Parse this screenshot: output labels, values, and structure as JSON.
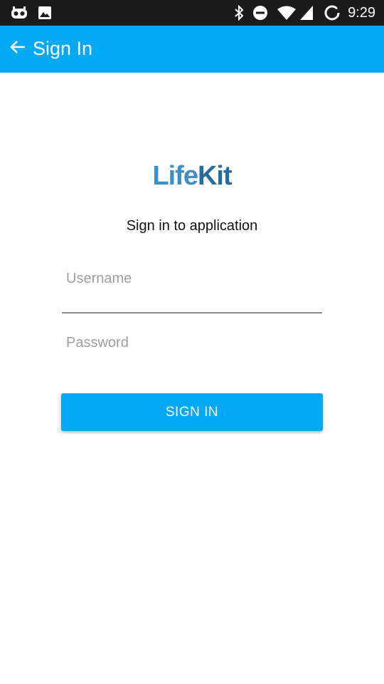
{
  "status_bar": {
    "time": "9:29",
    "left_icons": [
      "cyanogen-icon",
      "image-notification-icon"
    ],
    "right_icons": [
      "bluetooth-icon",
      "do-not-disturb-icon",
      "wifi-icon",
      "cell-signal-icon",
      "battery-charging-icon"
    ]
  },
  "app_bar": {
    "title": "Sign In",
    "back_icon": "arrow-back-icon",
    "color": "#03a9f4"
  },
  "logo": {
    "part1": "Life",
    "part2": "Kit"
  },
  "subtitle": "Sign in to application",
  "form": {
    "username_placeholder": "Username",
    "username_value": "",
    "password_placeholder": "Password",
    "password_value": "",
    "submit_label": "SIGN IN"
  }
}
